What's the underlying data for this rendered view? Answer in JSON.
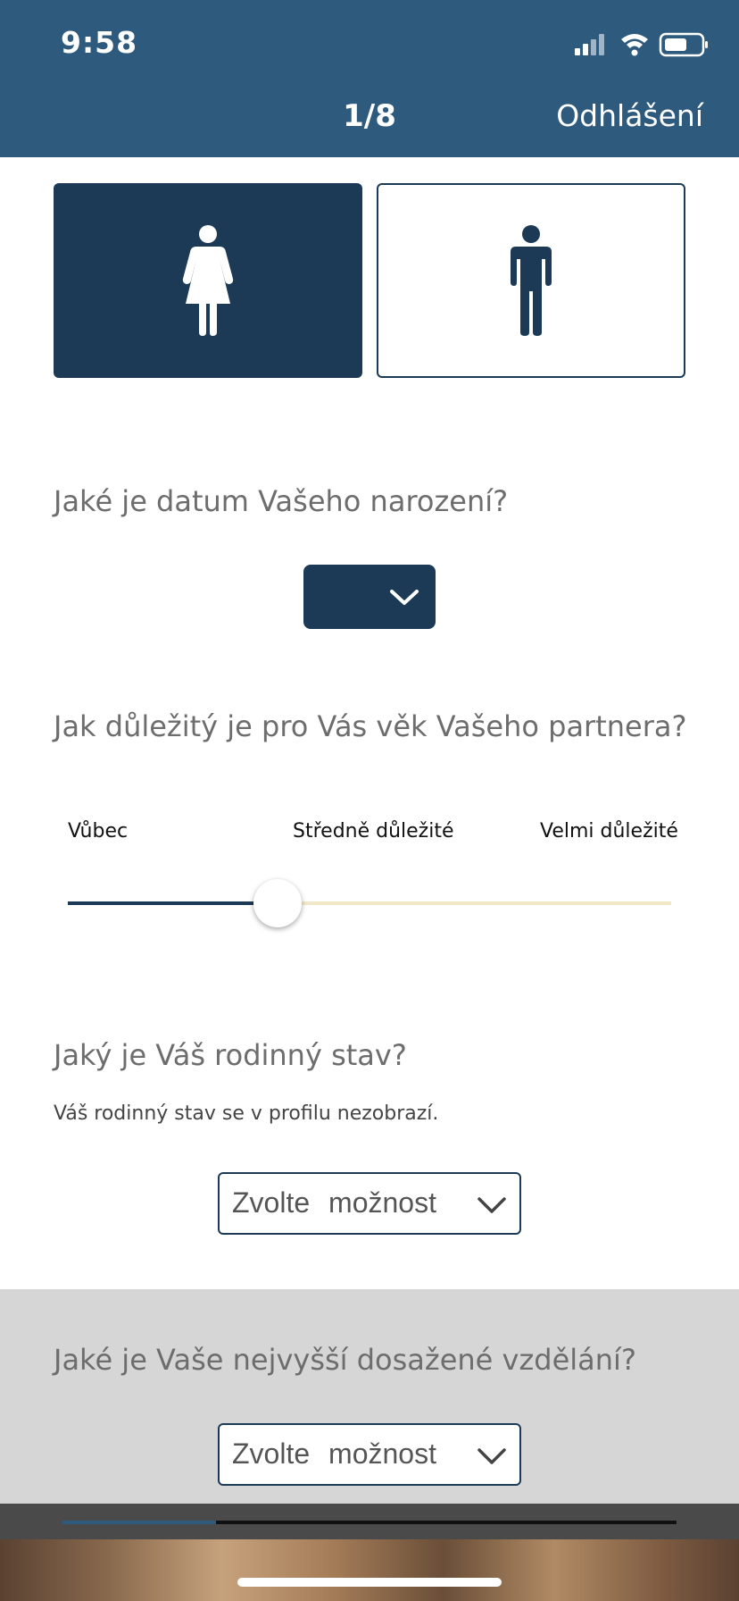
{
  "status_bar": {
    "time": "9:58",
    "icons": [
      "signal-icon",
      "wifi-icon",
      "battery-icon"
    ]
  },
  "header": {
    "step": "1/8",
    "logout_label": "Odhlášení"
  },
  "gender": {
    "options": [
      {
        "icon": "female-icon",
        "selected": true
      },
      {
        "icon": "male-icon",
        "selected": false
      }
    ]
  },
  "birthdate": {
    "question": "Jaké je datum Vašeho narození?",
    "value": ""
  },
  "partner_age": {
    "question": "Jak důležitý je pro Vás věk Vašeho partnera?",
    "labels": [
      "Vůbec",
      "Středně důležité",
      "Velmi důležité"
    ],
    "value_fraction": 0.35
  },
  "marital_status": {
    "question": "Jaký je Váš rodinný stav?",
    "hint": "Váš rodinný stav se v profilu nezobrazí.",
    "placeholder": "Zvolte možnost"
  },
  "education": {
    "question": "Jaké je Vaše nejvyšší dosažené vzdělání?",
    "placeholder": "Zvolte možnost"
  },
  "progress": {
    "fraction": 0.25
  },
  "colors": {
    "header": "#2e5a7e",
    "primary": "#1c3a55",
    "slider_empty": "#f0e6c8"
  }
}
